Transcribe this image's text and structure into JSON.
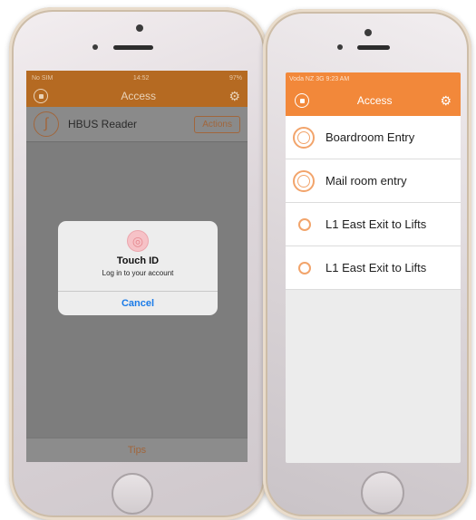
{
  "left_phone": {
    "status": {
      "carrier": "No SIM",
      "time": "14:52",
      "battery": "97%"
    },
    "nav": {
      "title": "Access",
      "menu_icon": "stop-circle-icon",
      "settings_icon": "gears-icon"
    },
    "reader": {
      "name": "HBUS Reader",
      "actions_label": "Actions"
    },
    "dialog": {
      "title": "Touch ID",
      "subtitle": "Log in to your account",
      "cancel_label": "Cancel"
    },
    "tips_label": "Tips"
  },
  "right_phone": {
    "status": {
      "carrier": "Voda NZ",
      "network": "3G",
      "time": "9:23 AM"
    },
    "nav": {
      "title": "Access",
      "menu_icon": "stop-circle-icon",
      "settings_icon": "gears-icon"
    },
    "doors": [
      {
        "label": "Boardroom Entry"
      },
      {
        "label": "Mail room entry"
      },
      {
        "label": "L1 East Exit to Lifts"
      },
      {
        "label": "L1 East Exit to Lifts"
      }
    ]
  },
  "colors": {
    "accent_left": "#b56a22",
    "accent_right": "#f2883a",
    "link_blue": "#1a7be8"
  }
}
